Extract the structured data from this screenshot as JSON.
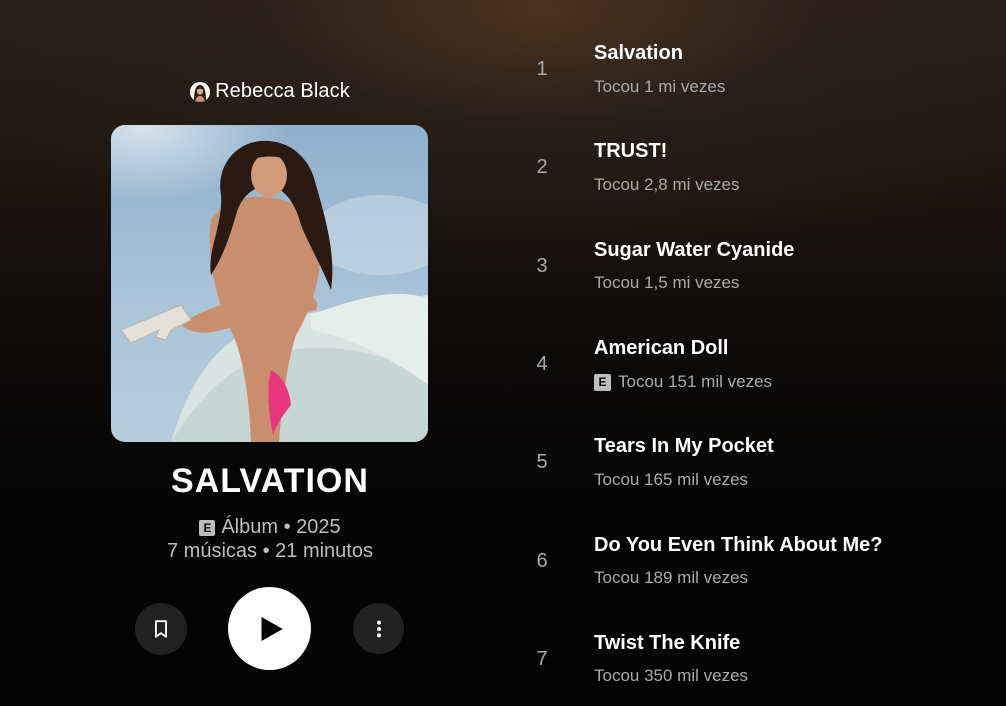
{
  "album": {
    "artist_name": "Rebecca Black",
    "title": "SALVATION",
    "explicit_badge": "E",
    "type_year": "Álbum • 2025",
    "counts": "7 músicas • 21 minutos"
  },
  "actions": {
    "save_icon": "bookmark-icon",
    "play_icon": "play-icon",
    "more_icon": "more-vert-icon"
  },
  "tracks": [
    {
      "number": "1",
      "title": "Salvation",
      "plays": "Tocou 1 mi vezes",
      "explicit": false
    },
    {
      "number": "2",
      "title": "TRUST!",
      "plays": "Tocou 2,8 mi vezes",
      "explicit": false
    },
    {
      "number": "3",
      "title": "Sugar Water Cyanide",
      "plays": "Tocou 1,5 mi vezes",
      "explicit": false
    },
    {
      "number": "4",
      "title": "American Doll",
      "plays": "Tocou 151 mil vezes",
      "explicit": true,
      "badge": "E"
    },
    {
      "number": "5",
      "title": "Tears In My Pocket",
      "plays": "Tocou 165 mil vezes",
      "explicit": false
    },
    {
      "number": "6",
      "title": "Do You Even Think About Me?",
      "plays": "Tocou 189 mil vezes",
      "explicit": false
    },
    {
      "number": "7",
      "title": "Twist The Knife",
      "plays": "Tocou 350 mil vezes",
      "explicit": false
    }
  ],
  "colors": {
    "background": "#030303",
    "header_glow": "#4a3422",
    "primary_text": "#ffffff",
    "secondary_text": "#aaaaaa",
    "button_surface": "#212121",
    "play_button": "#ffffff"
  }
}
